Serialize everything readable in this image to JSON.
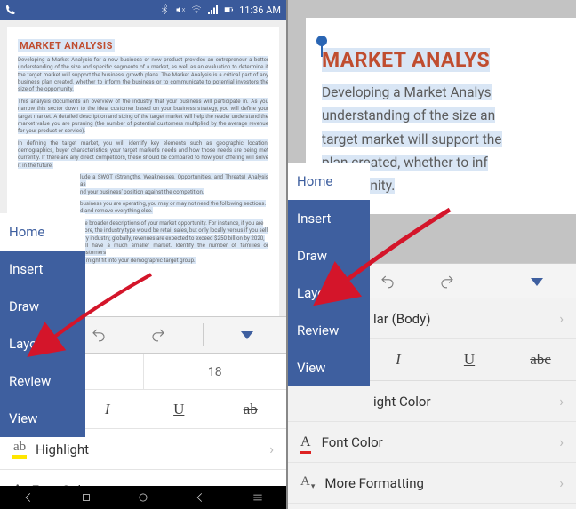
{
  "statusbar": {
    "time": "11:36 AM"
  },
  "document": {
    "title": "MARKET ANALYSIS",
    "p1": "Developing a Market Analysis for a new business or new product provides an entrepreneur a better understanding of the size and specific segments of a market, as well as an evaluation to determine if the target market will support the business' growth plans. The Market Analysis is a critical part of any business plan created, whether to inform the business or to communicate to potential investors the size of the opportunity.",
    "p2": "This analysis documents an overview of the industry that your business will participate in. As you narrow this sector down to the ideal customer based on your business strategy, you will define your target market. A detailed description and sizing of the target market will help the reader understand the market value you are pursuing (the number of potential customers multiplied by the average revenue for your product or service).",
    "p3": "In defining the target market, you will identify key elements such as geographic location, demographics, buyer characteristics, your target market's needs and how those needs are being met currently. If there are any direct competitors, these should be compared to how your offering will solve it in the future.",
    "p4a": "lude a SWOT (Strengths, Weaknesses, Opportunities, and Threats) Analysis as",
    "p4b": "nd your business' position against the competition.",
    "p5a": "business you are operating, you may or may not need the following sections.",
    "p5b": "d and remove everything else.",
    "p6a": "the broader descriptions of your market opportunity. For instance, if you are",
    "p6b": "store, the industry type would be retail sales, but only locally versus if you sell",
    "p6c": "elry industry, globally, revenues are expected to exceed $250 billion by 2020,",
    "p6d": "will have a much smaller market. Identify the number of families or customers",
    "p6e": "at might fit into your demographic target group."
  },
  "menu": {
    "home": "Home",
    "insert": "Insert",
    "draw": "Draw",
    "layout": "Layout",
    "review": "Review",
    "view": "View"
  },
  "format": {
    "font_size": "18",
    "italic": "I",
    "underline": "U",
    "strike": "ab",
    "strike_r": "abc",
    "highlight": "Highlight",
    "font_color": "Font Color",
    "body_partial": "lar (Body)",
    "hlcolor_partial": "ight Color",
    "more_formatting": "More Formatting"
  },
  "rdoc": {
    "title": "MARKET ANALYS",
    "l1": "Developing a Market Analys",
    "l2": "understanding of the size an",
    "l3": "target market will support the",
    "l4": "plan created, whether to inf",
    "l5": "opportunity."
  }
}
